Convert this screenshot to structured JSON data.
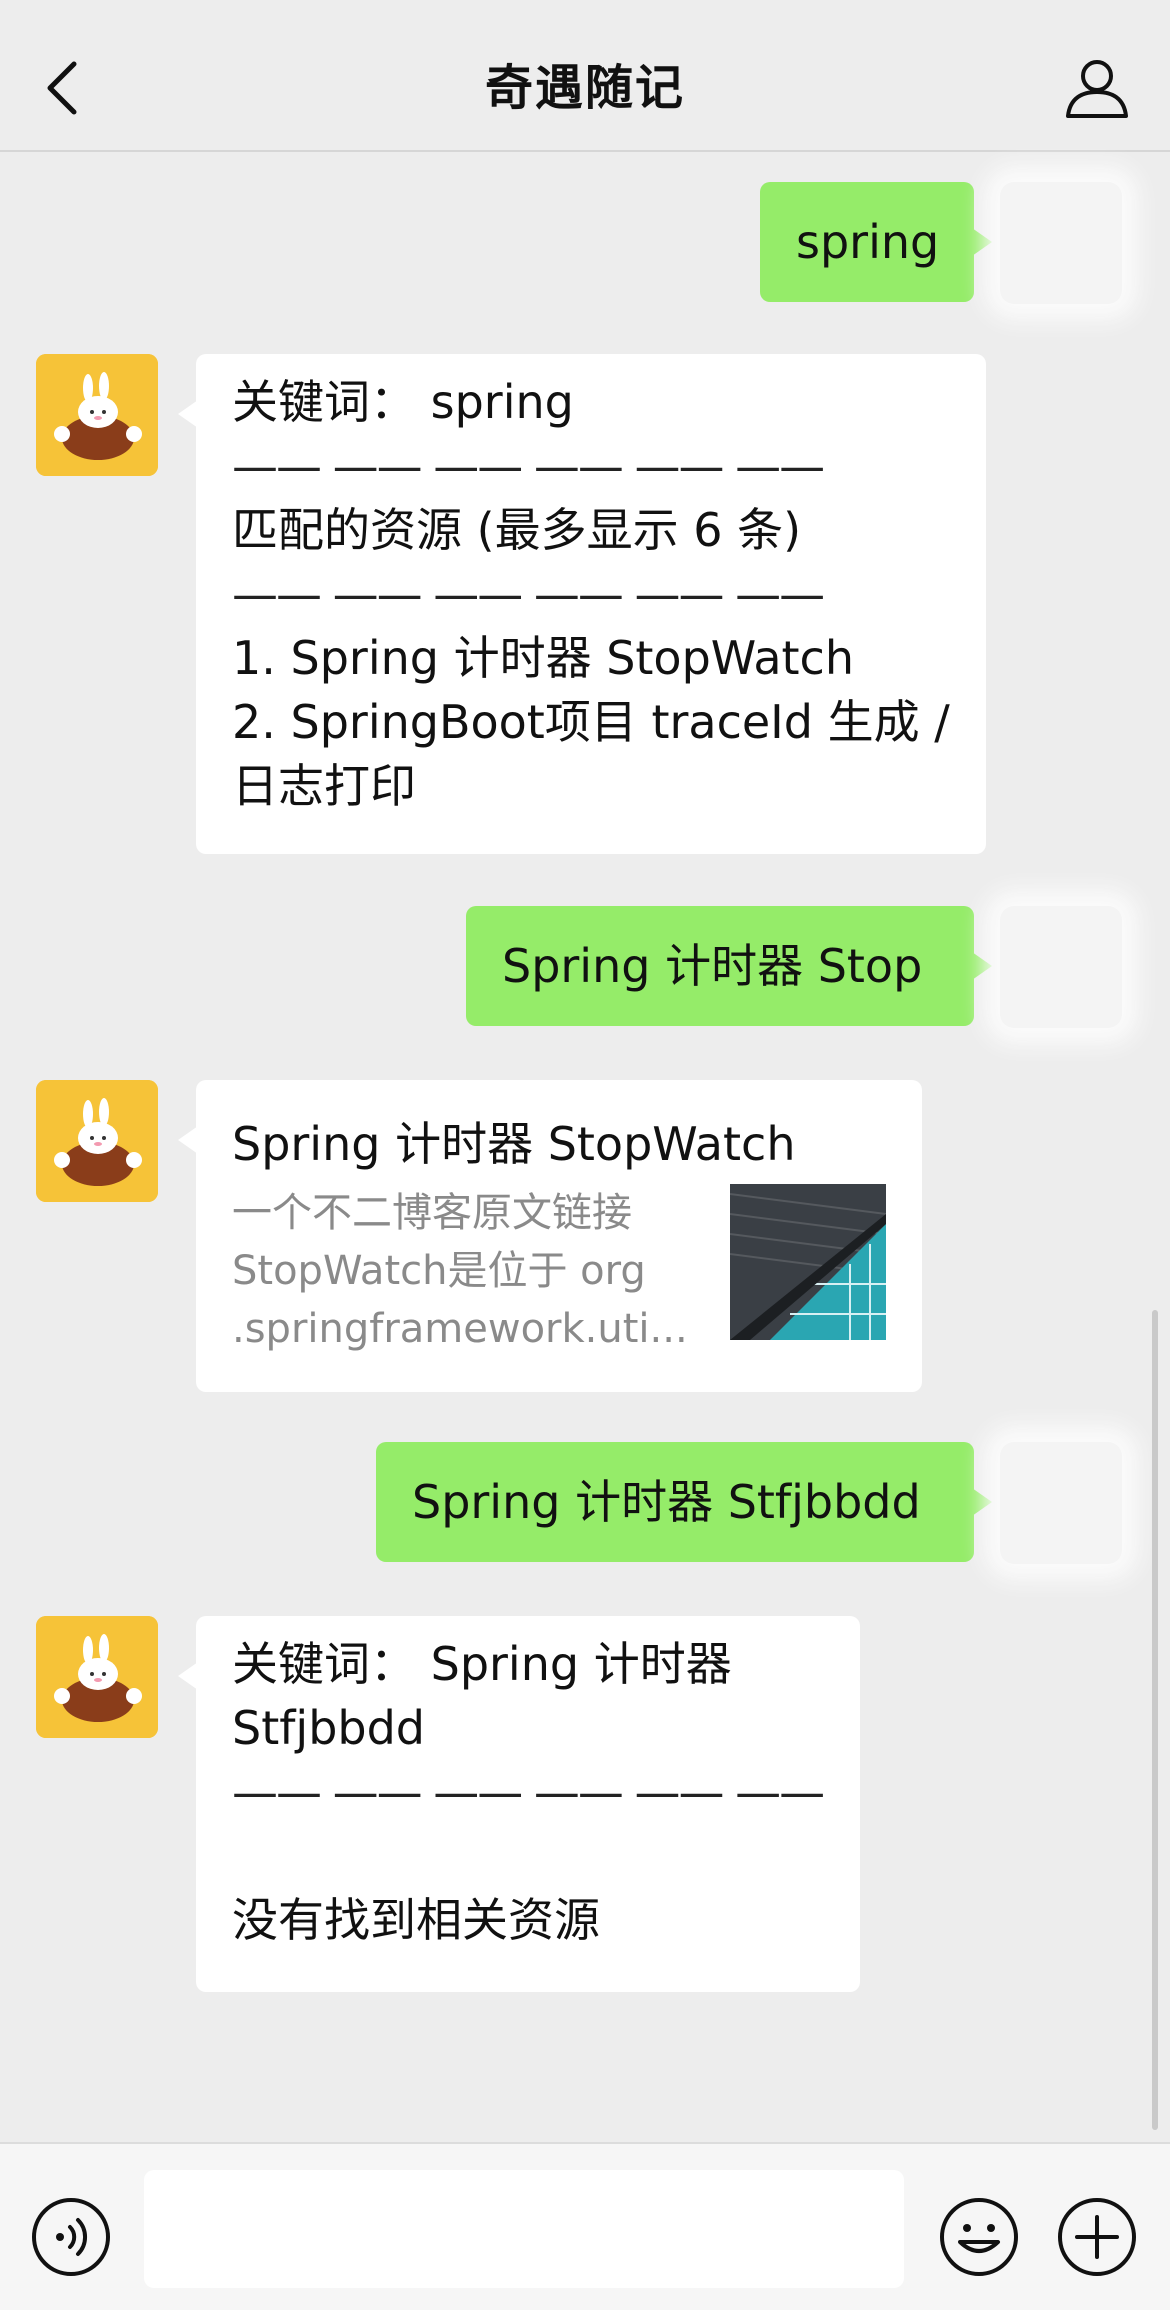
{
  "header": {
    "title": "奇遇随记",
    "back_icon": "chevron-left-icon",
    "profile_icon": "person-icon"
  },
  "messages": [
    {
      "side": "right",
      "text": "spring"
    },
    {
      "side": "left",
      "lines": [
        "关键词：  spring",
        "—— —— —— —— —— ——",
        "匹配的资源 (最多显示 6 条)",
        "—— —— —— —— —— ——",
        "1. Spring 计时器 StopWatch",
        "2. SpringBoot项目 traceId 生成 /",
        "日志打印"
      ]
    },
    {
      "side": "right",
      "text": "Spring 计时器 Stop"
    },
    {
      "side": "left",
      "card": {
        "title": "Spring 计时器 StopWatch",
        "desc": [
          "一个不二博客原文链接",
          "StopWatch是位于 org",
          ".springframework.uti..."
        ]
      }
    },
    {
      "side": "right",
      "text": "Spring 计时器 Stfjbbdd"
    },
    {
      "side": "left",
      "lines": [
        "关键词：  Spring 计时器",
        "Stfjbbdd",
        "—— —— —— —— —— ——",
        "",
        "没有找到相关资源"
      ]
    }
  ],
  "input_bar": {
    "placeholder": "",
    "voice_icon": "voice-icon",
    "emoji_icon": "emoji-icon",
    "plus_icon": "plus-circle-icon"
  },
  "colors": {
    "background": "#ededed",
    "self_bubble": "#95ec69",
    "other_bubble": "#ffffff",
    "avatar_bg": "#f6c338"
  }
}
